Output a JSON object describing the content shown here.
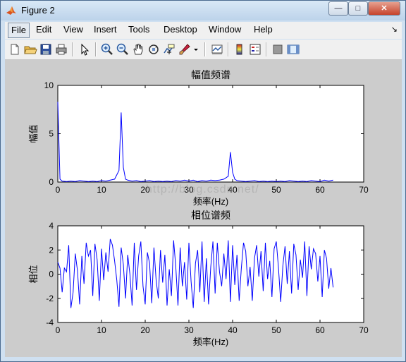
{
  "window": {
    "title": "Figure 2",
    "controls": {
      "minimize": "—",
      "maximize": "□",
      "close": "✕"
    }
  },
  "menubar": {
    "items": [
      "File",
      "Edit",
      "View",
      "Insert",
      "Tools",
      "Desktop",
      "Window",
      "Help"
    ],
    "dock_arrow": "↘"
  },
  "toolbar": {
    "buttons": [
      "new-figure-icon",
      "open-file-icon",
      "save-icon",
      "print-icon",
      "pointer-icon",
      "zoom-in-icon",
      "zoom-out-icon",
      "pan-hand-icon",
      "rotate-3d-icon",
      "data-cursor-icon",
      "brush-icon",
      "dropdown-arrow-icon",
      "link-plot-icon",
      "colorbar-icon",
      "legend-icon",
      "hide-plot-tools-icon",
      "show-plot-tools-icon"
    ]
  },
  "watermark": "http://blog.csdn.net/",
  "chart_data": [
    {
      "type": "line",
      "title": "幅值频谱",
      "xlabel": "频率(Hz)",
      "ylabel": "幅值",
      "xlim": [
        0,
        70
      ],
      "ylim": [
        0,
        10
      ],
      "xticks": [
        0,
        10,
        20,
        30,
        40,
        50,
        60,
        70
      ],
      "yticks": [
        0,
        5,
        10
      ],
      "color": "#0000ff",
      "x": [
        0,
        0.5,
        1,
        2,
        3,
        4,
        5,
        6,
        7,
        8,
        9,
        10,
        11,
        12,
        13,
        14,
        14.5,
        15,
        15.5,
        16,
        17,
        18,
        19,
        20,
        21,
        22,
        23,
        24,
        25,
        26,
        27,
        28,
        29,
        30,
        31,
        32,
        33,
        34,
        35,
        36,
        37,
        38,
        39,
        39.5,
        40,
        40.5,
        41,
        42,
        43,
        44,
        45,
        46,
        47,
        48,
        49,
        50,
        51,
        52,
        53,
        54,
        55,
        56,
        57,
        58,
        59,
        60,
        61,
        62,
        63
      ],
      "y": [
        8.3,
        0.3,
        0.1,
        0.05,
        0.1,
        0.05,
        0.15,
        0.1,
        0.05,
        0.1,
        0.05,
        0.15,
        0.1,
        0.2,
        0.3,
        1.2,
        7.2,
        1.5,
        0.3,
        0.2,
        0.1,
        0.15,
        0.05,
        0.1,
        0.15,
        0.05,
        0.1,
        0.05,
        0.1,
        0.05,
        0.15,
        0.1,
        0.2,
        0.1,
        0.2,
        0.05,
        0.15,
        0.1,
        0.2,
        0.15,
        0.2,
        0.3,
        0.6,
        3.1,
        1.0,
        0.3,
        0.15,
        0.1,
        0.05,
        0.1,
        0.15,
        0.05,
        0.1,
        0.05,
        0.1,
        0.05,
        0.1,
        0.05,
        0.15,
        0.1,
        0.05,
        0.1,
        0.05,
        0.15,
        0.1,
        0.05,
        0.2,
        0.1,
        0.2
      ]
    },
    {
      "type": "line",
      "title": "相位谱频",
      "xlabel": "频率(Hz)",
      "ylabel": "相位",
      "xlim": [
        0,
        70
      ],
      "ylim": [
        -4,
        4
      ],
      "xticks": [
        0,
        10,
        20,
        30,
        40,
        50,
        60,
        70
      ],
      "yticks": [
        -4,
        -2,
        0,
        2,
        4
      ],
      "color": "#0000ff",
      "x": [
        0,
        0.5,
        1,
        1.5,
        2,
        2.5,
        3,
        3.5,
        4,
        4.5,
        5,
        5.5,
        6,
        6.5,
        7,
        7.5,
        8,
        8.5,
        9,
        9.5,
        10,
        10.5,
        11,
        11.5,
        12,
        12.5,
        13,
        13.5,
        14,
        14.5,
        15,
        15.5,
        16,
        16.5,
        17,
        17.5,
        18,
        18.5,
        19,
        19.5,
        20,
        20.5,
        21,
        21.5,
        22,
        22.5,
        23,
        23.5,
        24,
        24.5,
        25,
        25.5,
        26,
        26.5,
        27,
        27.5,
        28,
        28.5,
        29,
        29.5,
        30,
        30.5,
        31,
        31.5,
        32,
        32.5,
        33,
        33.5,
        34,
        34.5,
        35,
        35.5,
        36,
        36.5,
        37,
        37.5,
        38,
        38.5,
        39,
        39.5,
        40,
        40.5,
        41,
        41.5,
        42,
        42.5,
        43,
        43.5,
        44,
        44.5,
        45,
        45.5,
        46,
        46.5,
        47,
        47.5,
        48,
        48.5,
        49,
        49.5,
        50,
        50.5,
        51,
        51.5,
        52,
        52.5,
        53,
        53.5,
        54,
        54.5,
        55,
        55.5,
        56,
        56.5,
        57,
        57.5,
        58,
        58.5,
        59,
        59.5,
        60,
        60.5,
        61,
        61.5,
        62,
        62.5,
        63
      ],
      "y": [
        1.0,
        0.5,
        -1.5,
        0.5,
        0.2,
        2.4,
        -2.8,
        -1.5,
        1.7,
        0.3,
        -2.5,
        1.5,
        -0.8,
        2.6,
        1.5,
        2.0,
        -1.8,
        2.5,
        1.2,
        -2.2,
        2.1,
        -0.5,
        1.8,
        0.2,
        2.9,
        2.4,
        1.1,
        -0.5,
        -2.7,
        2.2,
        0.8,
        -2.0,
        1.6,
        0.0,
        -2.6,
        2.6,
        -1.3,
        1.5,
        2.7,
        -1.0,
        -2.5,
        1.8,
        0.9,
        -2.4,
        2.2,
        -0.5,
        -2.0,
        2.0,
        -0.7,
        1.6,
        -2.6,
        0.4,
        -1.8,
        2.8,
        0.6,
        -2.6,
        2.2,
        -1.0,
        1.0,
        -2.1,
        2.6,
        -0.6,
        -2.8,
        0.9,
        2.0,
        -1.5,
        2.7,
        -2.3,
        1.3,
        -2.5,
        0.6,
        2.7,
        -1.6,
        2.6,
        0.2,
        -1.0,
        1.7,
        -0.4,
        2.8,
        -2.3,
        2.4,
        -0.9,
        1.6,
        -2.2,
        0.5,
        2.6,
        1.9,
        -1.0,
        0.6,
        -2.2,
        1.3,
        2.4,
        -0.2,
        1.9,
        -1.4,
        2.6,
        -0.4,
        1.1,
        -1.9,
        2.1,
        2.7,
        0.5,
        -2.3,
        0.7,
        2.3,
        -0.8,
        1.9,
        -1.6,
        2.5,
        1.6,
        -1.3,
        1.2,
        -0.3,
        2.7,
        -1.8,
        2.3,
        0.4,
        2.1,
        1.7,
        -0.6,
        1.5,
        -1.9,
        2.0,
        1.3,
        -1.2,
        0.5,
        -1.1,
        -2.8,
        -2.1,
        0.4,
        -1.5,
        -0.7,
        1.3,
        -0.6,
        3.1,
        -2.2,
        -1.3
      ]
    }
  ]
}
